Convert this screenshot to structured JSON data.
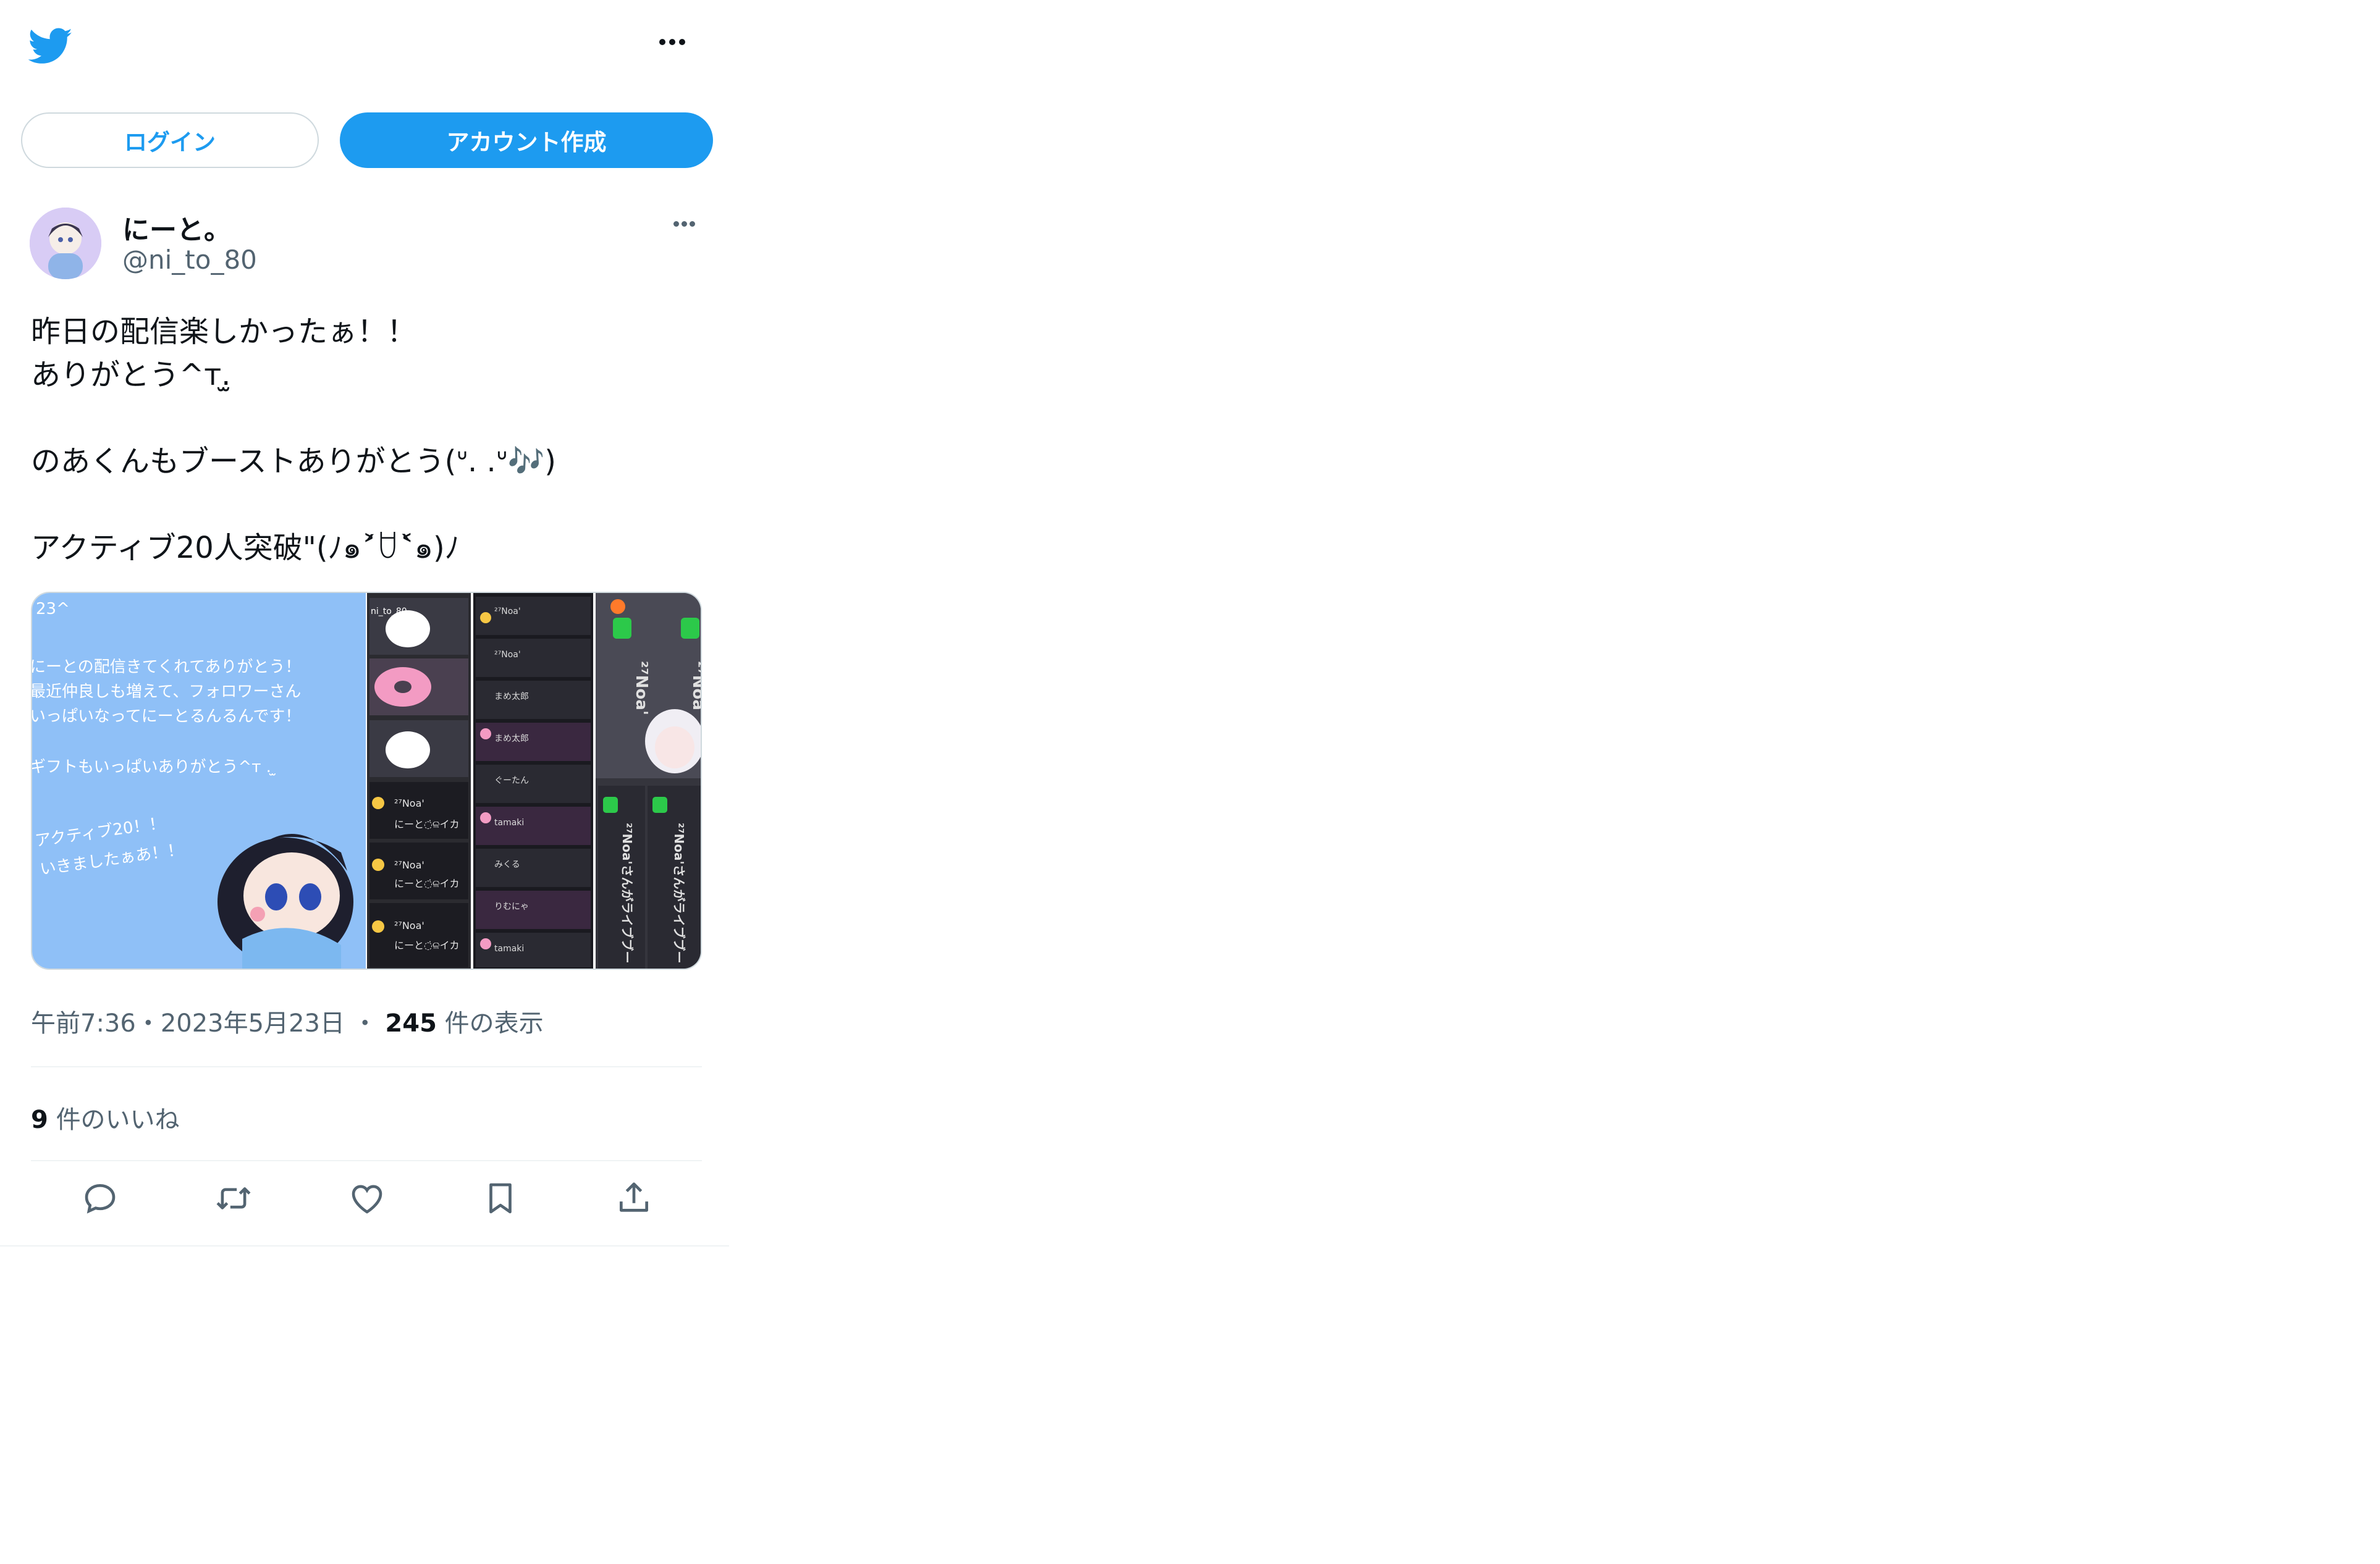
{
  "header": {
    "logo_icon": "twitter-bird-icon",
    "more_icon": "more-horizontal-icon",
    "brand_color": "#1d9bf0"
  },
  "auth": {
    "login_label": "ログイン",
    "signup_label": "アカウント作成"
  },
  "tweet": {
    "author_name": "にーと。",
    "author_handle": "@ni_to_80",
    "text_lines": [
      "昨日の配信楽しかったぁ！！",
      "ありがとう^т.̫",
      "",
      "のあくんもブーストありがとう(ᐡ. .ᐡ🎶)",
      "",
      "アクティブ20人突破\"(ﾉ๑˃́ꇴ˂̀๑)ﾉ"
    ],
    "media": {
      "left_card_text": [
        "23^",
        "にーとの配信きてくれてありがとう！",
        "最近仲良しも増えて、フォロワーさん",
        "いっぱいなってにーとるんるんです！",
        "ギフトもいっぱいありがとう^т . ̫",
        "アクティブ20！！",
        "いきましたぁあ！！"
      ],
      "handle_snippet": "ni_to_80",
      "stream_labels": [
        "²⁷Noa'",
        "にーと◌̇ଳ̇イカ",
        "まめ太郎",
        "ぐーたん",
        "tamaki",
        "みくる",
        "りむにゃ"
      ],
      "side_label": "²⁷Noa'さんがライブブー"
    },
    "timestamp": "午前7:36・2023年5月23日",
    "separator": "・",
    "views_count": "245",
    "views_label": "件の表示",
    "likes_count": "9",
    "likes_label": "件のいいね"
  },
  "actions": {
    "reply_icon": "reply-icon",
    "retweet_icon": "retweet-icon",
    "like_icon": "heart-icon",
    "bookmark_icon": "bookmark-icon",
    "share_icon": "share-icon"
  }
}
